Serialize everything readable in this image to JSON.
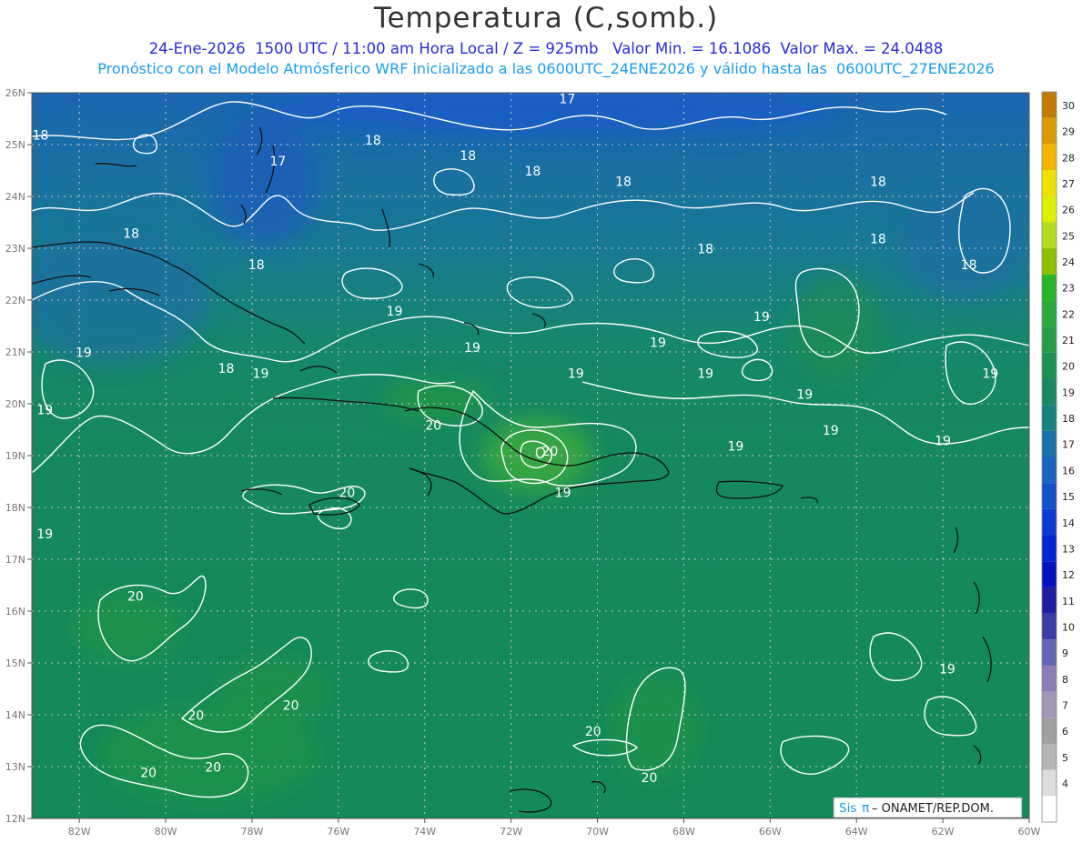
{
  "header": {
    "title": "Temperatura (C,somb.)",
    "line1": "24-Ene-2026  1500 UTC / 11:00 am Hora Local / Z = 925mb   Valor Min. = 16.1086  Valor Max. = 24.0488",
    "line2": "Pronóstico con el Modelo Atmósferico WRF inicializado a las 0600UTC_24ENE2026 y válido hasta las  0600UTC_27ENE2026"
  },
  "axes": {
    "lat_labels": [
      "26N",
      "25N",
      "24N",
      "23N",
      "22N",
      "21N",
      "20N",
      "19N",
      "18N",
      "17N",
      "16N",
      "15N",
      "14N",
      "13N",
      "12N"
    ],
    "lon_labels": [
      "82W",
      "80W",
      "78W",
      "76W",
      "74W",
      "72W",
      "70W",
      "68W",
      "66W",
      "64W",
      "62W",
      "60W"
    ]
  },
  "contour_labels": [
    {
      "text": "17",
      "lon": -70.7,
      "lat": 25.8
    },
    {
      "text": "17",
      "lon": -77.4,
      "lat": 24.6
    },
    {
      "text": "18",
      "lon": -82.9,
      "lat": 25.1
    },
    {
      "text": "18",
      "lon": -75.2,
      "lat": 25.0
    },
    {
      "text": "18",
      "lon": -73.0,
      "lat": 24.7
    },
    {
      "text": "18",
      "lon": -71.5,
      "lat": 24.4
    },
    {
      "text": "18",
      "lon": -69.4,
      "lat": 24.2
    },
    {
      "text": "18",
      "lon": -63.5,
      "lat": 24.2
    },
    {
      "text": "18",
      "lon": -80.8,
      "lat": 23.2
    },
    {
      "text": "18",
      "lon": -67.5,
      "lat": 22.9
    },
    {
      "text": "18",
      "lon": -63.5,
      "lat": 23.1
    },
    {
      "text": "18",
      "lon": -61.4,
      "lat": 22.6
    },
    {
      "text": "18",
      "lon": -77.9,
      "lat": 22.6
    },
    {
      "text": "18",
      "lon": -78.6,
      "lat": 20.6
    },
    {
      "text": "19",
      "lon": -74.7,
      "lat": 21.7
    },
    {
      "text": "19",
      "lon": -72.9,
      "lat": 21.0
    },
    {
      "text": "19",
      "lon": -66.2,
      "lat": 21.6
    },
    {
      "text": "19",
      "lon": -68.6,
      "lat": 21.1
    },
    {
      "text": "19",
      "lon": -81.9,
      "lat": 20.9
    },
    {
      "text": "19",
      "lon": -77.8,
      "lat": 20.5
    },
    {
      "text": "19",
      "lon": -70.5,
      "lat": 20.5
    },
    {
      "text": "19",
      "lon": -67.5,
      "lat": 20.5
    },
    {
      "text": "19",
      "lon": -60.9,
      "lat": 20.5
    },
    {
      "text": "19",
      "lon": -65.2,
      "lat": 20.1
    },
    {
      "text": "19",
      "lon": -82.8,
      "lat": 19.8
    },
    {
      "text": "19",
      "lon": -64.6,
      "lat": 19.4
    },
    {
      "text": "19",
      "lon": -66.8,
      "lat": 19.1
    },
    {
      "text": "19",
      "lon": -62.0,
      "lat": 19.2
    },
    {
      "text": "19",
      "lon": -70.8,
      "lat": 18.2
    },
    {
      "text": "19",
      "lon": -82.8,
      "lat": 17.4
    },
    {
      "text": "19",
      "lon": -61.9,
      "lat": 14.8
    },
    {
      "text": "20",
      "lon": -73.8,
      "lat": 19.5
    },
    {
      "text": "20",
      "lon": -71.1,
      "lat": 19.0
    },
    {
      "text": "20",
      "lon": -75.8,
      "lat": 18.2
    },
    {
      "text": "20",
      "lon": -80.7,
      "lat": 16.2
    },
    {
      "text": "20",
      "lon": -77.1,
      "lat": 14.1
    },
    {
      "text": "20",
      "lon": -79.3,
      "lat": 13.9
    },
    {
      "text": "20",
      "lon": -70.1,
      "lat": 13.6
    },
    {
      "text": "20",
      "lon": -78.9,
      "lat": 12.9
    },
    {
      "text": "20",
      "lon": -80.4,
      "lat": 12.8
    },
    {
      "text": "20",
      "lon": -68.8,
      "lat": 12.7
    }
  ],
  "colorbar": [
    {
      "label": "30",
      "color": "#c07c00"
    },
    {
      "label": "29",
      "color": "#dc9a00"
    },
    {
      "label": "28",
      "color": "#f2b400"
    },
    {
      "label": "27",
      "color": "#f0e000"
    },
    {
      "label": "26",
      "color": "#dcf000"
    },
    {
      "label": "25",
      "color": "#b4dc1e"
    },
    {
      "label": "24",
      "color": "#8cc000"
    },
    {
      "label": "23",
      "color": "#28b428"
    },
    {
      "label": "22",
      "color": "#2aaa3c"
    },
    {
      "label": "21",
      "color": "#249f48"
    },
    {
      "label": "20",
      "color": "#1a9250"
    },
    {
      "label": "19",
      "color": "#178a64"
    },
    {
      "label": "18",
      "color": "#14847e"
    },
    {
      "label": "17",
      "color": "#1a70a8"
    },
    {
      "label": "16",
      "color": "#1a64c0"
    },
    {
      "label": "15",
      "color": "#1450c8"
    },
    {
      "label": "14",
      "color": "#0a3cd2"
    },
    {
      "label": "13",
      "color": "#0028d2"
    },
    {
      "label": "12",
      "color": "#0014be"
    },
    {
      "label": "11",
      "color": "#1e1ea0"
    },
    {
      "label": "10",
      "color": "#3c3ca8"
    },
    {
      "label": "9",
      "color": "#6464b4"
    },
    {
      "label": "8",
      "color": "#8c7cb8"
    },
    {
      "label": "7",
      "color": "#a098b4"
    },
    {
      "label": "6",
      "color": "#a0a0a0"
    },
    {
      "label": "5",
      "color": "#b4b4b4"
    },
    {
      "label": "4",
      "color": "#dcdcdc"
    },
    {
      "label": "",
      "color": "#ffffff"
    }
  ],
  "credit": {
    "sis": "Sis",
    "pi": "π",
    "rest": "– ONAMET/REP.DOM."
  },
  "colors": {
    "grid": "#bbbbbb",
    "contour": "#ffffff",
    "coast": "#111111",
    "field_main": "#168a5a",
    "field_north": "#1a6ea0",
    "field_deep_north": "#1a5cb8"
  }
}
